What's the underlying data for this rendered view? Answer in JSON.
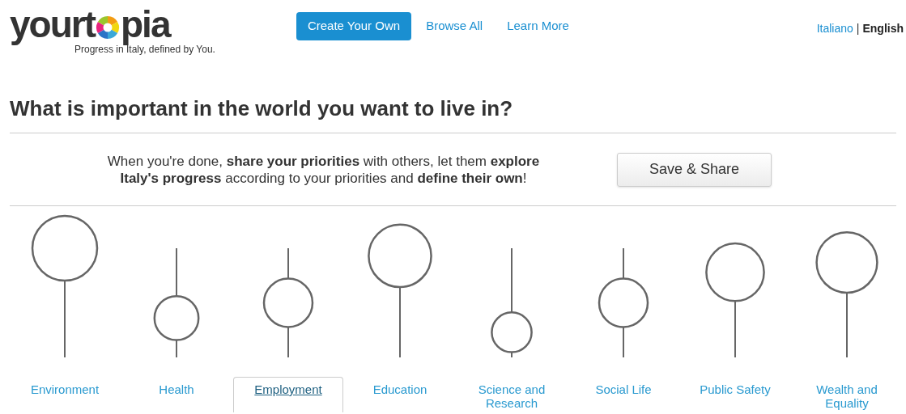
{
  "logo": {
    "parts": [
      "yourt",
      "pia"
    ],
    "tagline": "Progress in Italy, defined by You."
  },
  "nav": [
    {
      "label": "Create Your Own",
      "kind": "primary"
    },
    {
      "label": "Browse All",
      "kind": "link"
    },
    {
      "label": "Learn More",
      "kind": "link"
    }
  ],
  "languages": [
    {
      "label": "Italiano",
      "selected": false
    },
    {
      "label": "English",
      "selected": true
    }
  ],
  "language_separator": "|",
  "heading": "What is important in the world you want to live in?",
  "intro": "When you're done, **share your priorities** with others, let them **explore Italy's progress** according to your priorities and **define their own**!",
  "share_button": "Save & Share",
  "priorities": [
    {
      "label": "Environment",
      "level": 1,
      "selected": false
    },
    {
      "label": "Health",
      "level": 0.36,
      "selected": false
    },
    {
      "label": "Employment",
      "level": 0.5,
      "selected": true
    },
    {
      "label": "Education",
      "level": 0.93,
      "selected": false
    },
    {
      "label": "Science and Research",
      "level": 0.23,
      "selected": false
    },
    {
      "label": "Social Life",
      "level": 0.5,
      "selected": false
    },
    {
      "label": "Public Safety",
      "level": 0.78,
      "selected": false
    },
    {
      "label": "Wealth and Equality",
      "level": 0.87,
      "selected": false
    }
  ]
}
